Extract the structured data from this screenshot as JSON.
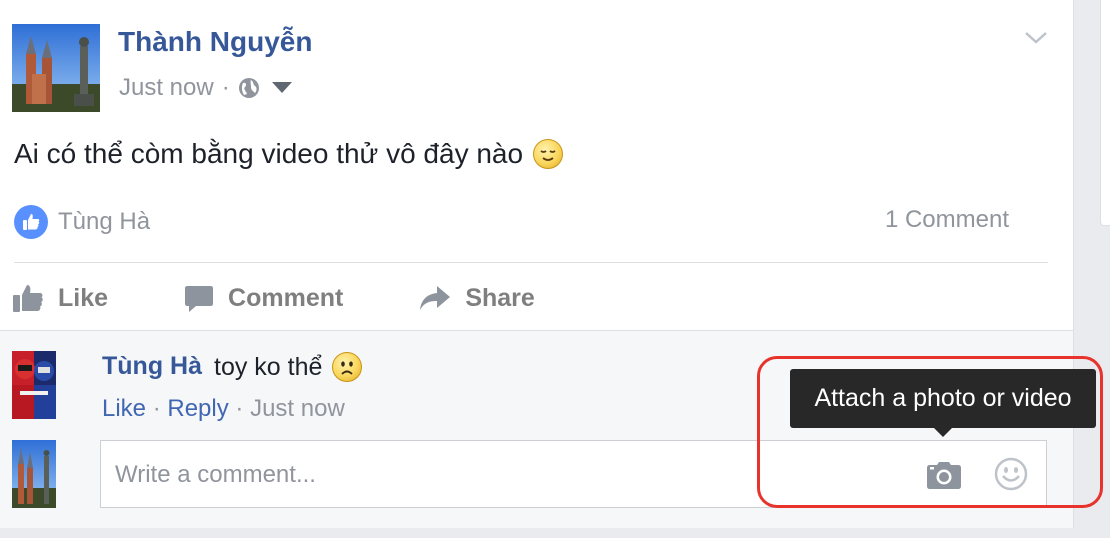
{
  "post": {
    "author": "Thành Nguyễn",
    "timestamp": "Just now",
    "separator": "·",
    "privacy_icon": "globe-icon",
    "text": "Ai có thể còm bằng video thử vô đây nào",
    "text_emoji": "relieved-smile-emoji",
    "reactions": {
      "icon": "like-icon",
      "names": "Tùng Hà"
    },
    "comment_count": "1 Comment"
  },
  "actions": {
    "like": "Like",
    "comment": "Comment",
    "share": "Share"
  },
  "comment": {
    "author": "Tùng Hà",
    "text": "toy ko thể",
    "text_emoji": "frown-emoji",
    "like": "Like",
    "reply": "Reply",
    "separator": "·",
    "timestamp": "Just now"
  },
  "composer": {
    "placeholder": "Write a comment...",
    "value": "",
    "camera_icon": "camera-icon",
    "emoji_icon": "smiley-icon"
  },
  "tooltip": {
    "text": "Attach a photo or video"
  },
  "colors": {
    "link": "#365899",
    "muted": "#90949c",
    "like_badge": "#5890ff",
    "tooltip_bg": "#282828",
    "highlight": "#e8332d"
  }
}
